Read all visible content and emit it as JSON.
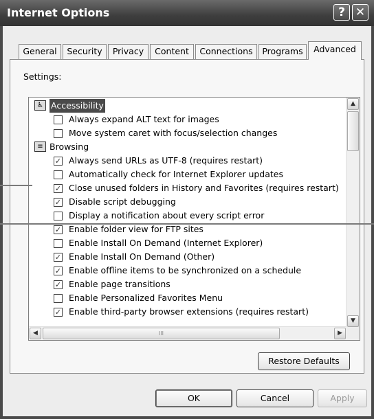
{
  "window": {
    "title": "Internet Options"
  },
  "titlebar": {
    "help_glyph": "?",
    "close_glyph": "✕"
  },
  "tabs": [
    {
      "label": "General"
    },
    {
      "label": "Security"
    },
    {
      "label": "Privacy"
    },
    {
      "label": "Content"
    },
    {
      "label": "Connections"
    },
    {
      "label": "Programs"
    },
    {
      "label": "Advanced",
      "active": true
    }
  ],
  "settings": {
    "label": "Settings:",
    "items": [
      {
        "type": "category",
        "icon": "accessibility-icon",
        "label": "Accessibility",
        "selected": true
      },
      {
        "type": "checkbox",
        "label": "Always expand ALT text for images",
        "checked": false
      },
      {
        "type": "checkbox",
        "label": "Move system caret with focus/selection changes",
        "checked": false
      },
      {
        "type": "category",
        "icon": "browsing-icon",
        "label": "Browsing",
        "selected": false
      },
      {
        "type": "checkbox",
        "label": "Always send URLs as UTF-8 (requires restart)",
        "checked": true
      },
      {
        "type": "checkbox",
        "label": "Automatically check for Internet Explorer updates",
        "checked": false
      },
      {
        "type": "checkbox",
        "label": "Close unused folders in History and Favorites (requires restart)",
        "checked": true
      },
      {
        "type": "checkbox",
        "label": "Disable script debugging",
        "checked": true
      },
      {
        "type": "checkbox",
        "label": "Display a notification about every script error",
        "checked": false
      },
      {
        "type": "checkbox",
        "label": "Enable folder view for FTP sites",
        "checked": true
      },
      {
        "type": "checkbox",
        "label": "Enable Install On Demand (Internet Explorer)",
        "checked": false
      },
      {
        "type": "checkbox",
        "label": "Enable Install On Demand (Other)",
        "checked": true
      },
      {
        "type": "checkbox",
        "label": "Enable offline items to be synchronized on a schedule",
        "checked": true
      },
      {
        "type": "checkbox",
        "label": "Enable page transitions",
        "checked": true
      },
      {
        "type": "checkbox",
        "label": "Enable Personalized Favorites Menu",
        "checked": false
      },
      {
        "type": "checkbox",
        "label": "Enable third-party browser extensions (requires restart)",
        "checked": true
      }
    ]
  },
  "scroll_glyphs": {
    "up": "▲",
    "down": "▼",
    "left": "◀",
    "right": "▶",
    "grip": "III"
  },
  "buttons": {
    "restore_defaults": "Restore Defaults",
    "ok": "OK",
    "cancel": "Cancel",
    "apply": "Apply"
  }
}
